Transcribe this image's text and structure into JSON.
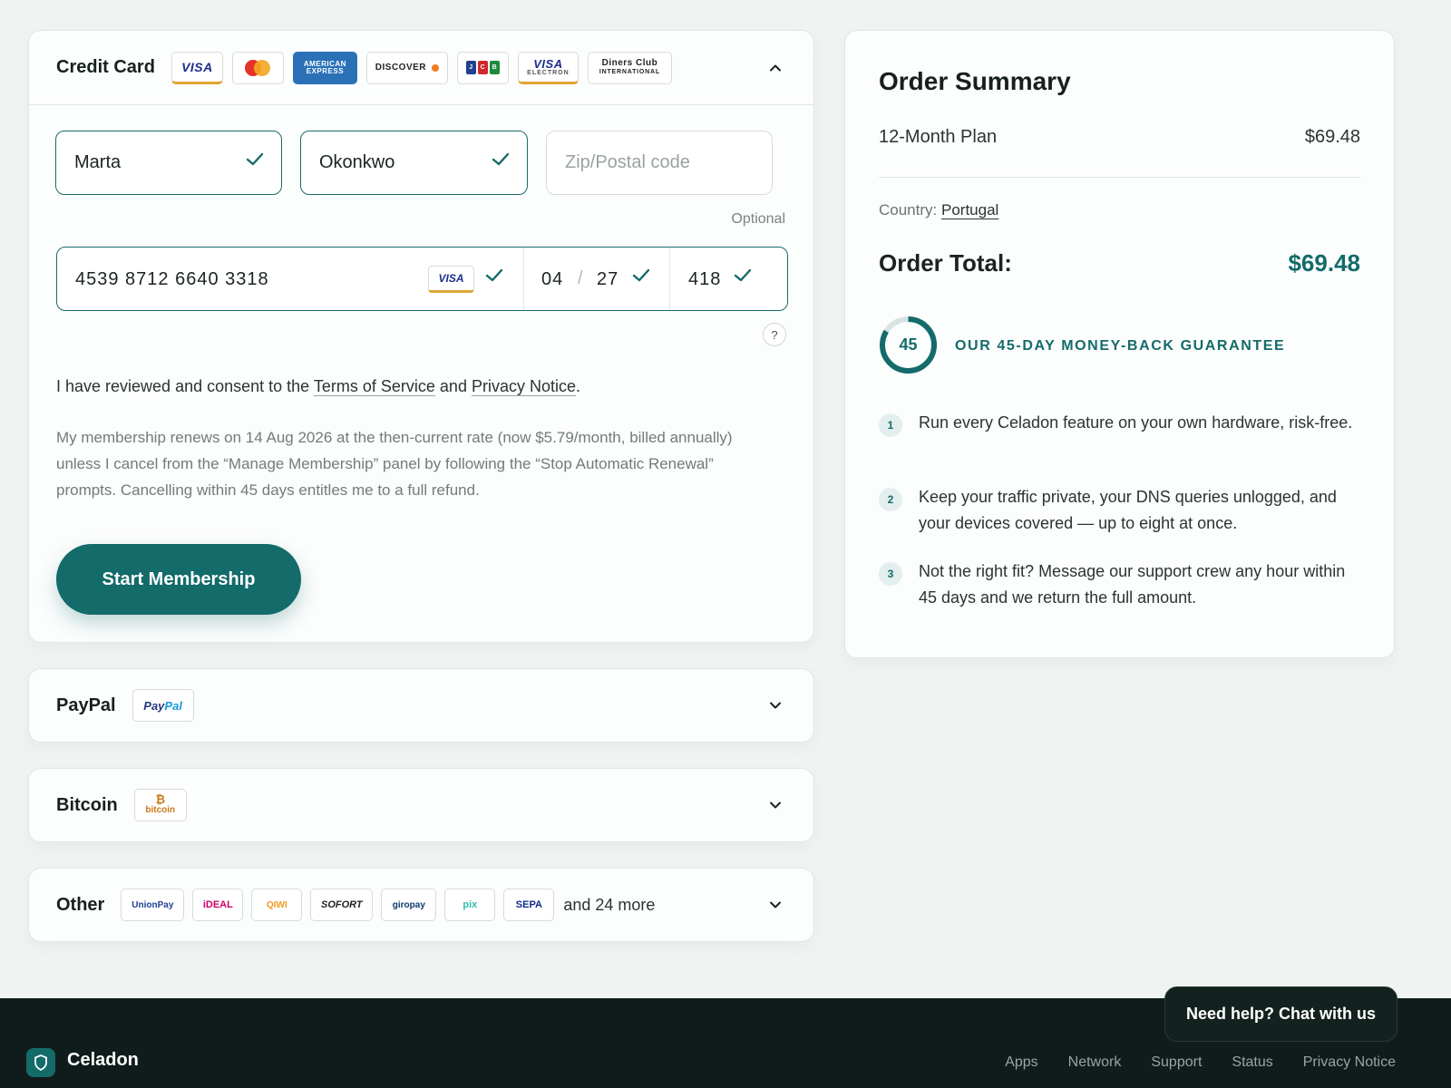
{
  "credit_card": {
    "title": "Credit Card",
    "logos": {
      "visa": "VISA",
      "amex_line1": "AMERICAN",
      "amex_line2": "EXPRESS",
      "discover": "DISCOVER",
      "jcb": [
        "J",
        "C",
        "B"
      ],
      "visa_electron_line1": "VISA",
      "visa_electron_line2": "ELECTRON",
      "diners_line1": "Diners Club",
      "diners_line2": "INTERNATIONAL"
    },
    "first_name": "Marta",
    "last_name": "Okonkwo",
    "zip_placeholder": "Zip/Postal code",
    "zip_note": "Optional",
    "card_number": "4539 8712 6640 3318",
    "card_brand": "VISA",
    "exp_month": "04",
    "exp_slash": "/",
    "exp_year": "27",
    "cvc": "418",
    "help": "?",
    "consent_prefix": "I have reviewed and consent to the ",
    "terms_link": "Terms of Service",
    "consent_and": " and ",
    "privacy_link": "Privacy Notice",
    "consent_suffix": ".",
    "renewal_text": "My membership renews on 14 Aug 2026 at the then-current rate (now $5.79/month, billed annually) unless I cancel from the “Manage Membership” panel by following the “Stop Automatic Renewal” prompts. Cancelling within 45 days entitles me to a full refund.",
    "submit_label": "Start Membership"
  },
  "paypal": {
    "title": "PayPal",
    "logo_a": "Pay",
    "logo_b": "Pal"
  },
  "bitcoin": {
    "title": "Bitcoin",
    "logo_symbol": "₿",
    "logo_text": "bitcoin"
  },
  "other": {
    "title": "Other",
    "logos": [
      "UnionPay",
      "iDEAL",
      "QIWI",
      "SOFORT",
      "giropay",
      "pix",
      "SEPA"
    ],
    "more": "and 24 more"
  },
  "summary": {
    "title": "Order Summary",
    "plan": "12-Month Plan",
    "plan_price": "$69.48",
    "country_label": "Country: ",
    "country": "Portugal",
    "total_label": "Order Total:",
    "total": "$69.48",
    "badge_days": "45",
    "guarantee": "OUR 45-DAY MONEY-BACK GUARANTEE",
    "points": [
      {
        "n": "1",
        "text": "Run every Celadon feature on your own hardware, risk-free."
      },
      {
        "n": "2",
        "text": "Keep your traffic private, your DNS queries unlogged, and your devices covered — up to eight at once."
      },
      {
        "n": "3",
        "text": "Not the right fit? Message our support crew any hour within 45 days and we return the full amount."
      }
    ]
  },
  "footer": {
    "brand": "Celadon",
    "links": [
      "Apps",
      "Network",
      "Support",
      "Status",
      "Privacy Notice"
    ]
  },
  "chat": {
    "label": "Need help? Chat with us"
  },
  "colors": {
    "accent": "#136b6a",
    "footer_bg": "#0f1c1b",
    "page_bg": "#f1f3f2"
  },
  "icons": [
    "chevron-up-icon",
    "chevron-down-icon",
    "check-icon",
    "shield-icon"
  ]
}
